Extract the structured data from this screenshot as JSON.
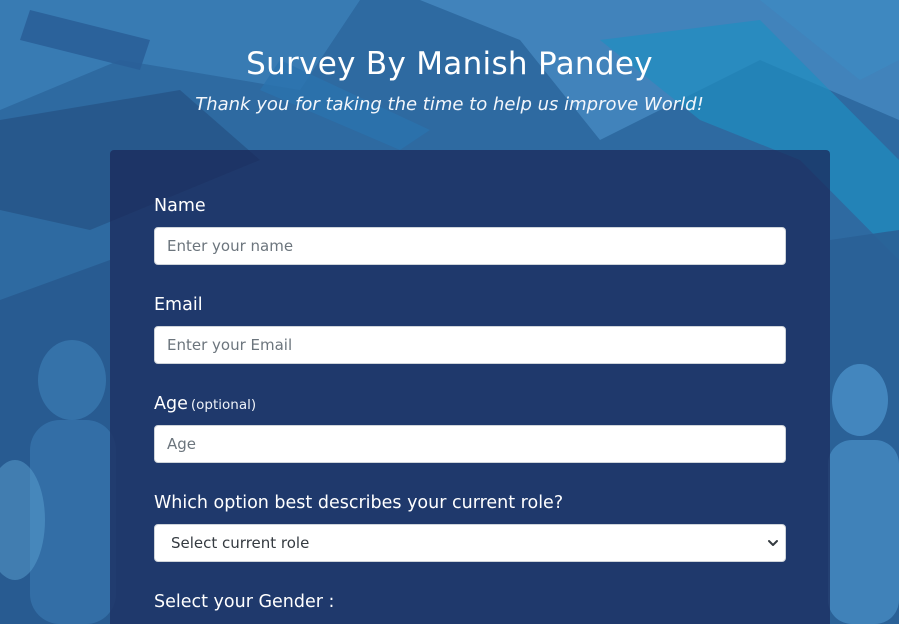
{
  "header": {
    "title": "Survey By Manish Pandey",
    "subtitle": "Thank you for taking the time to help us improve World!"
  },
  "form": {
    "name": {
      "label": "Name",
      "placeholder": "Enter your name"
    },
    "email": {
      "label": "Email",
      "placeholder": "Enter your Email"
    },
    "age": {
      "label": "Age",
      "hint": "(optional)",
      "placeholder": "Age"
    },
    "role": {
      "label": "Which option best describes your current role?",
      "selected": "Select current role"
    },
    "gender": {
      "label": "Select your Gender :"
    }
  },
  "colors": {
    "background": "#2f6ea5",
    "card": "#1b2757",
    "text": "#ffffff"
  },
  "icons": {
    "select_arrow": "chevron-down-icon"
  }
}
